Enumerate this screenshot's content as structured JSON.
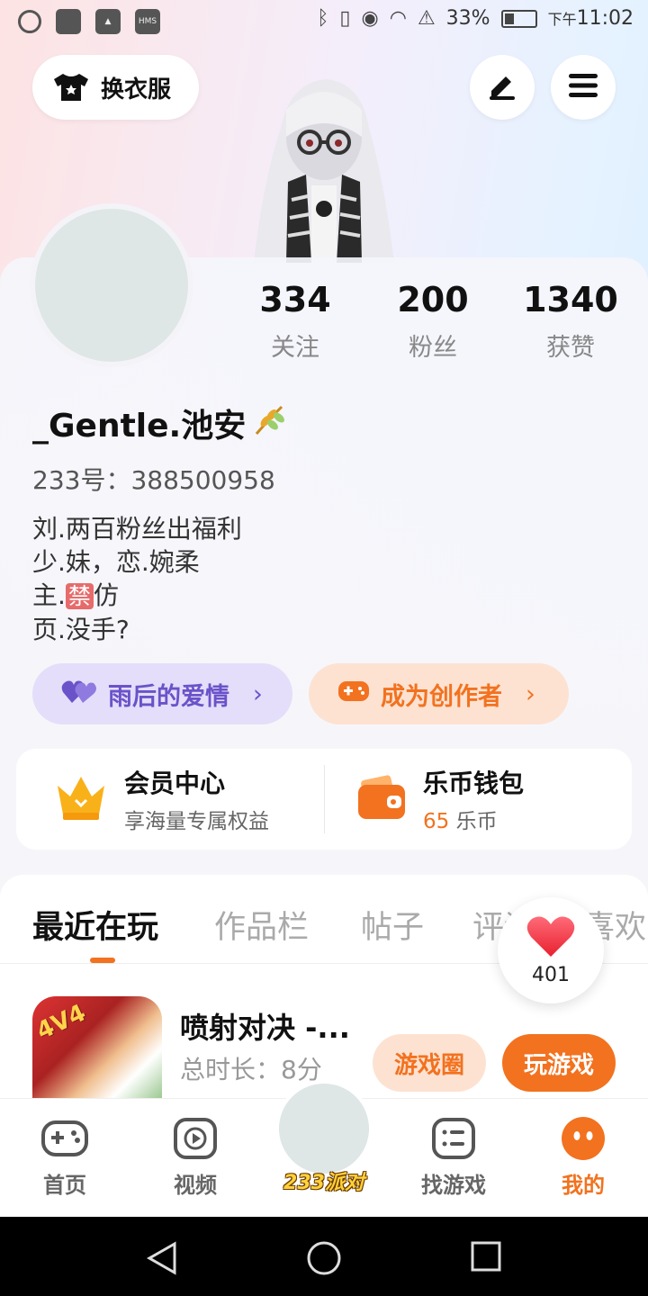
{
  "status_bar": {
    "left_icons": [
      "timer-icon",
      "app-icon",
      "gallery-icon",
      "hms-icon"
    ],
    "hms_label": "HMS",
    "battery": "33%",
    "time_prefix": "下午",
    "time": "11:02"
  },
  "top_bar": {
    "outfit_label": "换衣服"
  },
  "profile": {
    "stats": [
      {
        "value": "334",
        "label": "关注"
      },
      {
        "value": "200",
        "label": "粉丝"
      },
      {
        "value": "1340",
        "label": "获赞"
      }
    ],
    "username": "_Gentle.池安",
    "uid_text": "233号：388500958",
    "bio": {
      "line1": "刘.两百粉丝出福利",
      "line2": "少.妹，恋.婉柔",
      "line3_prefix": "主.",
      "line3_tag": "禁",
      "line3_suffix": "仿",
      "line4": "页.没手?"
    },
    "pills": {
      "love": "雨后的爱情",
      "creator": "成为创作者",
      "chevron": "›"
    }
  },
  "member_card": {
    "vip_title": "会员中心",
    "vip_sub": "享海量专属权益",
    "wallet_title": "乐币钱包",
    "wallet_amount": "65",
    "wallet_unit": " 乐币"
  },
  "tabs": [
    {
      "label": "最近在玩",
      "active": true
    },
    {
      "label": "作品栏"
    },
    {
      "label": "帖子"
    },
    {
      "label": "评论"
    },
    {
      "label": "喜欢"
    }
  ],
  "heart_bubble": {
    "count": "401"
  },
  "recent_game": {
    "badge": "4V4",
    "title": "喷射对决 -...",
    "playtime": "总时长：8分",
    "circle_button": "游戏圈",
    "play_button": "玩游戏"
  },
  "bottom_nav": {
    "home": "首页",
    "video": "视频",
    "party": "233派对",
    "find": "找游戏",
    "mine": "我的"
  },
  "colors": {
    "accent": "#f2721f",
    "purple": "#6a53c9"
  }
}
